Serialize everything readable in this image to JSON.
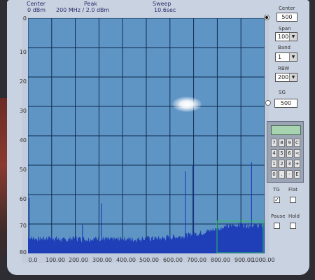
{
  "header": {
    "center_label": "Center",
    "span_label": "Span",
    "peak_label": "Peak",
    "peak_value": "200 MHz / 2.0 dBm",
    "sweep_label": "Sweep",
    "sweep_value": "10.6sec",
    "ref_value": "0 dBm"
  },
  "controls": {
    "center": {
      "label": "Center",
      "value": "500"
    },
    "span": {
      "label": "Span",
      "value": "1000"
    },
    "band": {
      "label": "Band",
      "value": "1"
    },
    "rbw": {
      "label": "RBW",
      "value": "200"
    },
    "sg": {
      "label": "SG",
      "value": "500"
    }
  },
  "keypad": {
    "display": "",
    "keys": [
      "7",
      "8",
      "9",
      "C",
      "4",
      "5",
      "6",
      "<",
      "1",
      "2",
      "3",
      "+",
      "0",
      ".",
      "-",
      "E"
    ]
  },
  "toggles": {
    "tg_label": "TG",
    "flat_label": "Flat",
    "pause_label": "Pause",
    "hold_label": "Hold",
    "tg_checked": true,
    "tg_check_glyph": "✓"
  },
  "chart_data": {
    "type": "area",
    "title": "",
    "xlabel": "",
    "ylabel": "",
    "xlim": [
      0,
      1000
    ],
    "ylim": [
      0,
      80
    ],
    "y_inverted": true,
    "grid": true,
    "x_ticks": [
      "0.0",
      "100.00",
      "200.00",
      "300.00",
      "400.00",
      "500.00",
      "600.00",
      "700.00",
      "800.00",
      "900.00",
      "1000.00"
    ],
    "y_ticks": [
      "0",
      "10",
      "20",
      "30",
      "40",
      "50",
      "60",
      "70",
      "80"
    ],
    "series": [
      {
        "floor_points": [
          [
            0,
            76
          ],
          [
            50,
            76.5
          ],
          [
            100,
            76
          ],
          [
            150,
            76.8
          ],
          [
            200,
            76.2
          ],
          [
            250,
            76.5
          ],
          [
            300,
            76.3
          ],
          [
            350,
            76.7
          ],
          [
            400,
            76.4
          ],
          [
            450,
            76.6
          ],
          [
            500,
            76.2
          ],
          [
            550,
            76.3
          ],
          [
            600,
            75.8
          ],
          [
            650,
            75.5
          ],
          [
            700,
            74.8
          ],
          [
            750,
            74.0
          ],
          [
            800,
            73.0
          ],
          [
            850,
            72.0
          ],
          [
            900,
            71.6
          ],
          [
            950,
            71.8
          ],
          [
            1000,
            72.0
          ]
        ],
        "spikes": [
          {
            "x": 2,
            "y": 61
          },
          {
            "x": 230,
            "y": 70
          },
          {
            "x": 310,
            "y": 63
          },
          {
            "x": 665,
            "y": 52
          },
          {
            "x": 695,
            "y": 50
          },
          {
            "x": 945,
            "y": 49
          }
        ]
      }
    ],
    "colors": {
      "plot_bg": "#5f95c5",
      "grid": "#0e2a4f",
      "trace": "#1e3fb8",
      "marker_box": "#2bbf5a"
    }
  }
}
